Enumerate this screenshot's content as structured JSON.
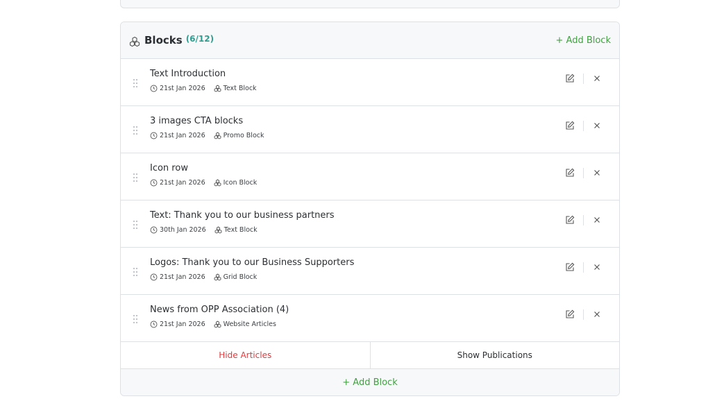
{
  "header": {
    "title": "Blocks",
    "count": "(6/12)",
    "add_block_label": "+ Add Block"
  },
  "blocks": [
    {
      "title": "Text Introduction",
      "date": "21st Jan 2026",
      "type": "Text Block"
    },
    {
      "title": "3 images CTA blocks",
      "date": "21st Jan 2026",
      "type": "Promo Block"
    },
    {
      "title": "Icon row",
      "date": "21st Jan 2026",
      "type": "Icon Block"
    },
    {
      "title": "Text: Thank you to our business partners",
      "date": "30th Jan 2026",
      "type": "Text Block"
    },
    {
      "title": "Logos: Thank you to our Business Supporters",
      "date": "21st Jan 2026",
      "type": "Grid Block"
    },
    {
      "title": "News from OPP Association (4)",
      "date": "21st Jan 2026",
      "type": "Website Articles"
    }
  ],
  "toggles": {
    "hide_label": "Hide Articles",
    "show_label": "Show Publications"
  },
  "footer": {
    "add_block_label": "+ Add Block"
  },
  "colors": {
    "accent_green": "#3fa23f",
    "count_teal": "#2f9e8f",
    "danger_red": "#e5383b"
  }
}
